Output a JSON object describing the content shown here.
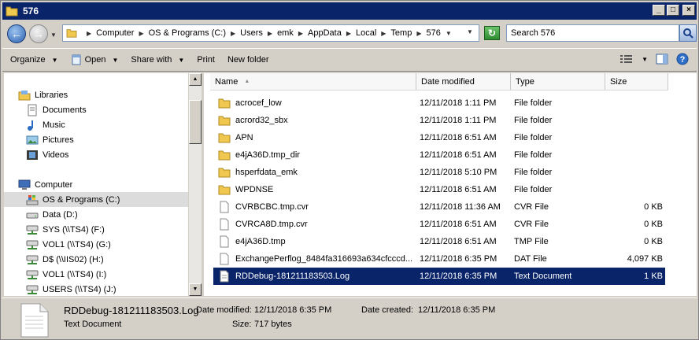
{
  "window": {
    "title": "576"
  },
  "address": {
    "crumbs": [
      "Computer",
      "OS & Programs (C:)",
      "Users",
      "emk",
      "AppData",
      "Local",
      "Temp",
      "576"
    ],
    "search_placeholder": "Search 576"
  },
  "toolbar": {
    "organize": "Organize",
    "open": "Open",
    "share_with": "Share with",
    "print": "Print",
    "new_folder": "New folder"
  },
  "nav": {
    "libraries": "Libraries",
    "documents": "Documents",
    "music": "Music",
    "pictures": "Pictures",
    "videos": "Videos",
    "computer": "Computer",
    "drives": [
      "OS & Programs (C:)",
      "Data (D:)",
      "SYS (\\\\TS4) (F:)",
      "VOL1 (\\\\TS4) (G:)",
      "D$ (\\\\IIS02) (H:)",
      "VOL1 (\\\\TS4) (I:)",
      "USERS (\\\\TS4) (J:)"
    ]
  },
  "columns": {
    "name": "Name",
    "date": "Date modified",
    "type": "Type",
    "size": "Size"
  },
  "files": [
    {
      "name": "acrocef_low",
      "date": "12/11/2018 1:11 PM",
      "type": "File folder",
      "size": "",
      "kind": "folder"
    },
    {
      "name": "acrord32_sbx",
      "date": "12/11/2018 1:11 PM",
      "type": "File folder",
      "size": "",
      "kind": "folder"
    },
    {
      "name": "APN",
      "date": "12/11/2018 6:51 AM",
      "type": "File folder",
      "size": "",
      "kind": "folder"
    },
    {
      "name": "e4jA36D.tmp_dir",
      "date": "12/11/2018 6:51 AM",
      "type": "File folder",
      "size": "",
      "kind": "folder"
    },
    {
      "name": "hsperfdata_emk",
      "date": "12/11/2018 5:10 PM",
      "type": "File folder",
      "size": "",
      "kind": "folder"
    },
    {
      "name": "WPDNSE",
      "date": "12/11/2018 6:51 AM",
      "type": "File folder",
      "size": "",
      "kind": "folder"
    },
    {
      "name": "CVRBCBC.tmp.cvr",
      "date": "12/11/2018 11:36 AM",
      "type": "CVR File",
      "size": "0 KB",
      "kind": "file"
    },
    {
      "name": "CVRCA8D.tmp.cvr",
      "date": "12/11/2018 6:51 AM",
      "type": "CVR File",
      "size": "0 KB",
      "kind": "file"
    },
    {
      "name": "e4jA36D.tmp",
      "date": "12/11/2018 6:51 AM",
      "type": "TMP File",
      "size": "0 KB",
      "kind": "file"
    },
    {
      "name": "ExchangePerflog_8484fa316693a634cfcccd...",
      "date": "12/11/2018 6:35 PM",
      "type": "DAT File",
      "size": "4,097 KB",
      "kind": "file"
    },
    {
      "name": "RDDebug-181211183503.Log",
      "date": "12/11/2018 6:35 PM",
      "type": "Text Document",
      "size": "1 KB",
      "kind": "text"
    }
  ],
  "details": {
    "filename": "RDDebug-181211183503.Log",
    "filetype": "Text Document",
    "modified_label": "Date modified:",
    "modified_value": "12/11/2018 6:35 PM",
    "created_label": "Date created:",
    "created_value": "12/11/2018 6:35 PM",
    "size_label": "Size:",
    "size_value": "717 bytes"
  }
}
